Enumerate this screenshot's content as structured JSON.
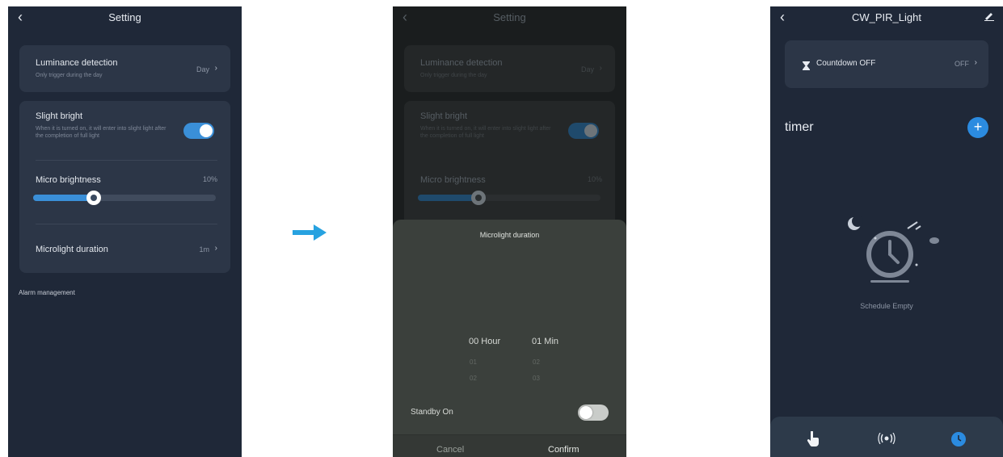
{
  "screen1": {
    "title": "Setting",
    "luminance": {
      "label": "Luminance detection",
      "sub": "Only trigger during the day",
      "value": "Day"
    },
    "slight_bright": {
      "label": "Slight bright",
      "sub": "When it is turned on, it will enter into slight light after the completion of full light",
      "enabled": true
    },
    "micro_brightness": {
      "label": "Micro brightness",
      "value": "10%",
      "level": 0.33
    },
    "microlight_duration": {
      "label": "Microlight duration",
      "value": "1m"
    },
    "alarm_management": "Alarm management"
  },
  "screen2": {
    "title": "Setting",
    "dim_luminance_label": "Luminance detection",
    "dim_luminance_sub": "Only trigger during the day",
    "dim_luminance_value": "Day",
    "dim_slight_label": "Slight bright",
    "dim_slight_sub": "When it is turned on, it will enter into slight light after the completion of full light",
    "dim_micro_label": "Micro brightness",
    "dim_micro_value": "10%",
    "sheet": {
      "title": "Microlight duration",
      "hour_selected": "00 Hour",
      "min_selected": "01 Min",
      "hour_next1": "01",
      "hour_next2": "02",
      "min_next1": "02",
      "min_next2": "03",
      "standby_label": "Standby On",
      "standby_on": false,
      "cancel": "Cancel",
      "confirm": "Confirm"
    }
  },
  "screen3": {
    "title": "CW_PIR_Light",
    "countdown_label": "Countdown OFF",
    "countdown_value": "OFF",
    "timer_label": "timer",
    "empty_text": "Schedule Empty"
  },
  "colors": {
    "accent": "#3a8fd8",
    "panel": "#1f2838",
    "card": "#2c3647",
    "arrow": "#27a2e0"
  },
  "icons": [
    "back-icon",
    "chevron-right-icon",
    "edit-icon",
    "hourglass-icon",
    "plus-icon",
    "clock-icon",
    "moon-icon",
    "cloud-icon",
    "hand-pointer-icon",
    "radio-waves-icon",
    "timer-tab-icon",
    "arrow-right-icon"
  ]
}
